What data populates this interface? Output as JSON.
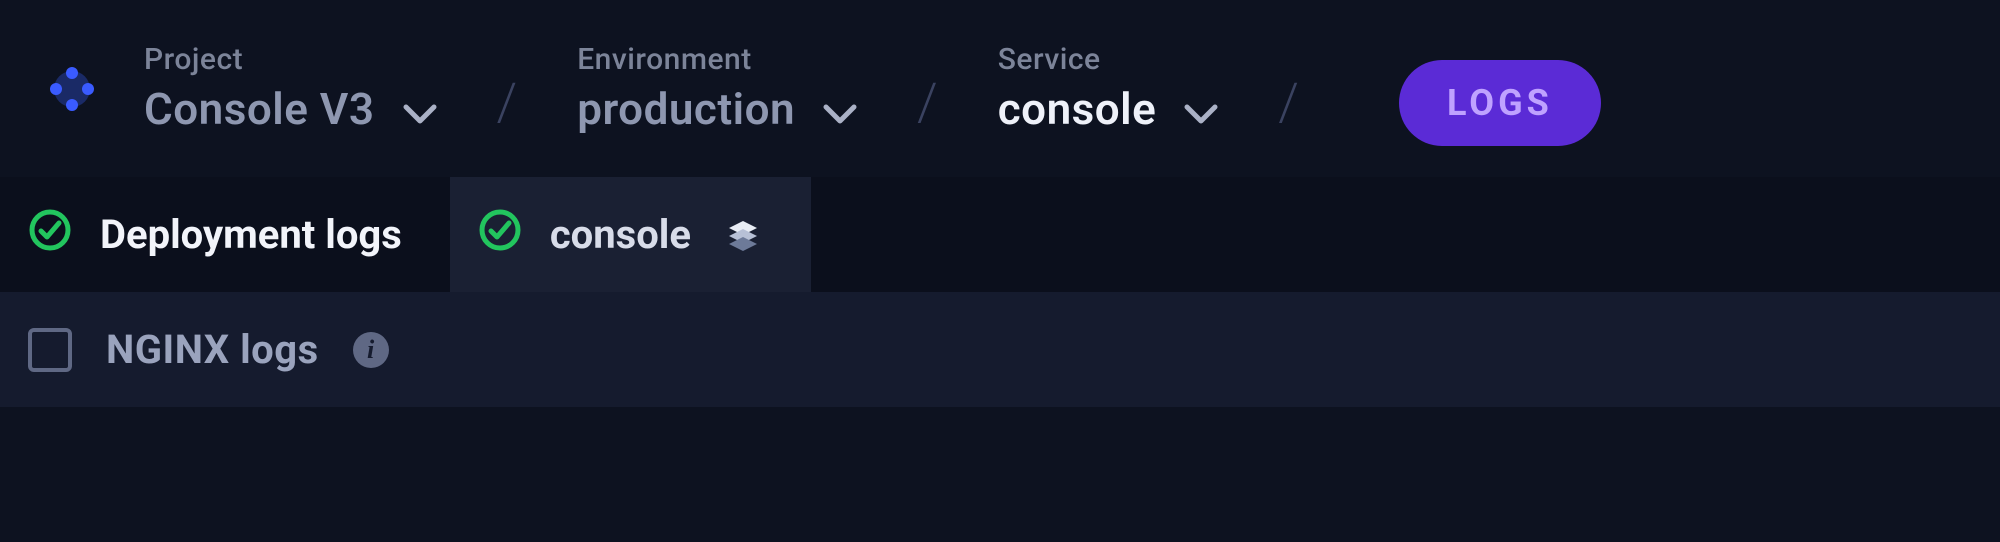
{
  "breadcrumb": {
    "project": {
      "label": "Project",
      "value": "Console V3"
    },
    "environment": {
      "label": "Environment",
      "value": "production"
    },
    "service": {
      "label": "Service",
      "value": "console"
    }
  },
  "logs_pill": "LOGS",
  "tabs": [
    {
      "label": "Deployment logs"
    },
    {
      "label": "console"
    }
  ],
  "option": {
    "label": "NGINX logs"
  }
}
